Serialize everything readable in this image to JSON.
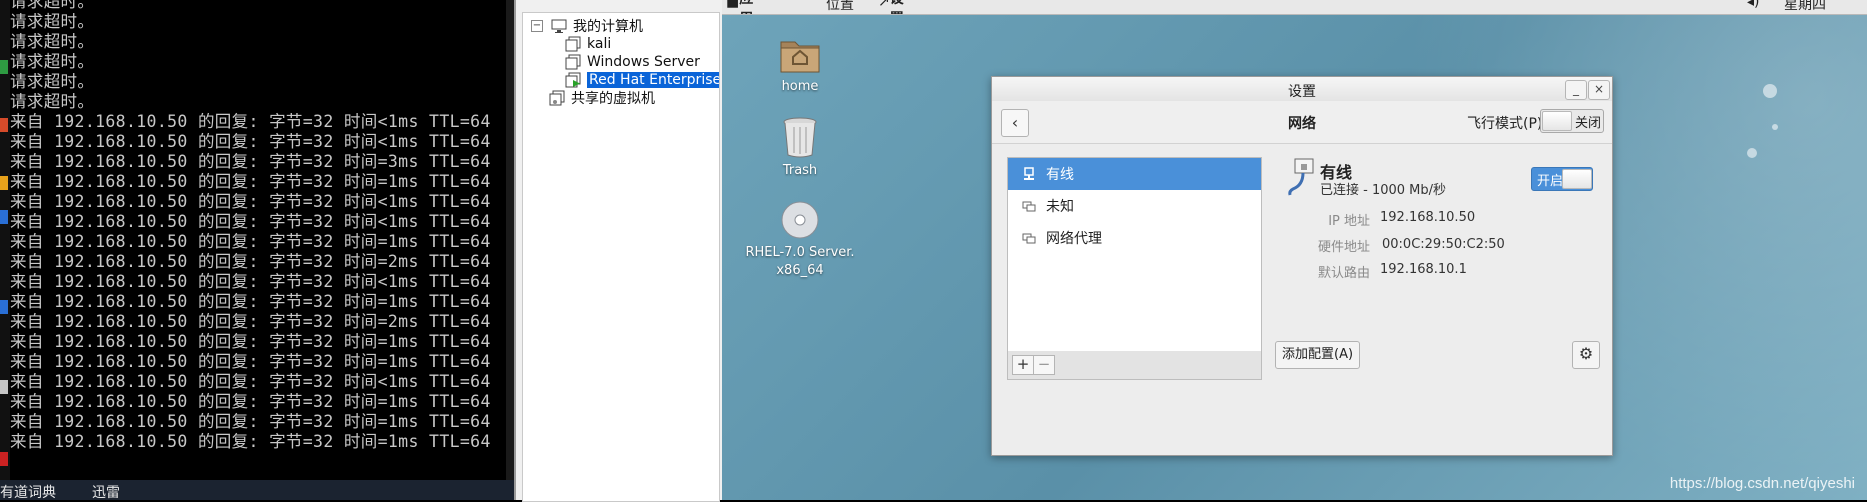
{
  "console": {
    "lines": [
      "请求超时。",
      "请求超时。",
      "请求超时。",
      "请求超时。",
      "请求超时。",
      "请求超时。",
      "来自 192.168.10.50 的回复: 字节=32 时间<1ms TTL=64",
      "来自 192.168.10.50 的回复: 字节=32 时间<1ms TTL=64",
      "来自 192.168.10.50 的回复: 字节=32 时间=3ms TTL=64",
      "来自 192.168.10.50 的回复: 字节=32 时间=1ms TTL=64",
      "来自 192.168.10.50 的回复: 字节=32 时间<1ms TTL=64",
      "来自 192.168.10.50 的回复: 字节=32 时间<1ms TTL=64",
      "来自 192.168.10.50 的回复: 字节=32 时间=1ms TTL=64",
      "来自 192.168.10.50 的回复: 字节=32 时间=2ms TTL=64",
      "来自 192.168.10.50 的回复: 字节=32 时间<1ms TTL=64",
      "来自 192.168.10.50 的回复: 字节=32 时间=1ms TTL=64",
      "来自 192.168.10.50 的回复: 字节=32 时间=2ms TTL=64",
      "来自 192.168.10.50 的回复: 字节=32 时间=1ms TTL=64",
      "来自 192.168.10.50 的回复: 字节=32 时间=1ms TTL=64",
      "来自 192.168.10.50 的回复: 字节=32 时间<1ms TTL=64",
      "来自 192.168.10.50 的回复: 字节=32 时间=1ms TTL=64",
      "来自 192.168.10.50 的回复: 字节=32 时间=1ms TTL=64",
      "来自 192.168.10.50 的回复: 字节=32 时间=1ms TTL=64"
    ]
  },
  "taskbar": {
    "item1": "有道词典",
    "item2": "迅雷"
  },
  "vm_tree": {
    "root": "我的计算机",
    "root_toggle": "−",
    "vms": [
      "kali",
      "Windows Server",
      "Red Hat Enterprise"
    ],
    "shared": "共享的虚拟机"
  },
  "gnome": {
    "topbar": {
      "apps": "应用程序",
      "places": "位置",
      "settings": "设置",
      "clock": "星期四"
    },
    "icons": {
      "home": "home",
      "trash": "Trash",
      "dvd_line1": "RHEL-7.0 Server.",
      "dvd_line2": "x86_64",
      "dvd_badge": "DVD"
    },
    "watermark": "https://blog.csdn.net/qiyeshi"
  },
  "settings_window": {
    "title": "设置",
    "minimize": "_",
    "close": "×",
    "back": "‹",
    "header": "网络",
    "airplane_label": "飞行模式(P)",
    "airplane_state": "关闭",
    "list": [
      "有线",
      "未知",
      "网络代理"
    ],
    "add": "+",
    "remove": "−",
    "add_config": "添加配置(A)",
    "gear": "⚙",
    "detail": {
      "title": "有线",
      "status": "已连接 - 1000 Mb/秒",
      "toggle": "开启",
      "ip_label": "IP 地址",
      "ip": "192.168.10.50",
      "mac_label": "硬件地址",
      "mac": "00:0C:29:50:C2:50",
      "route_label": "默认路由",
      "route": "192.168.10.1"
    }
  },
  "colors": {
    "accent": "#4a90d9",
    "selection": "#0a64d8",
    "desktop": "#5e95ad"
  }
}
